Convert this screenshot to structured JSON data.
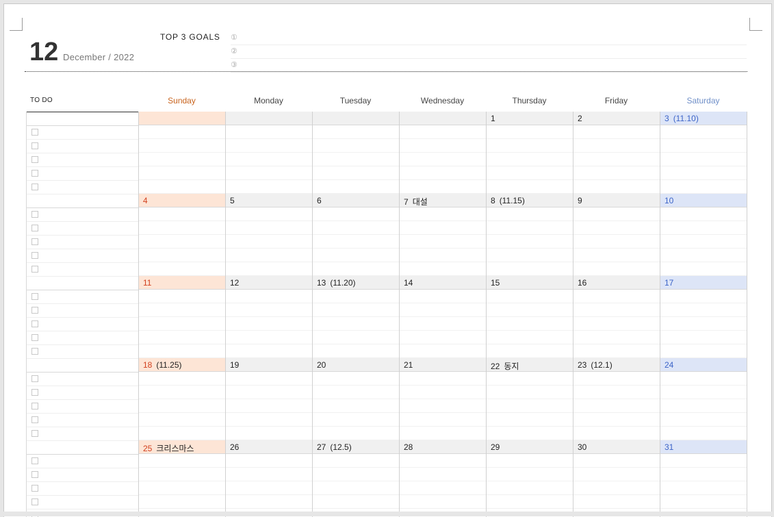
{
  "header": {
    "day_number": "12",
    "month_year": "December / 2022",
    "goals_title": "TOP 3 GOALS",
    "goal_markers": [
      "①",
      "②",
      "③"
    ]
  },
  "calendar": {
    "todo_label": "TO DO",
    "weekdays": [
      "Sunday",
      "Monday",
      "Tuesday",
      "Wednesday",
      "Thursday",
      "Friday",
      "Saturday"
    ],
    "weeks": [
      [
        {
          "d": "",
          "n": ""
        },
        {
          "d": "",
          "n": ""
        },
        {
          "d": "",
          "n": ""
        },
        {
          "d": "",
          "n": ""
        },
        {
          "d": "1",
          "n": ""
        },
        {
          "d": "2",
          "n": ""
        },
        {
          "d": "3",
          "n": "(11.10)"
        }
      ],
      [
        {
          "d": "4",
          "n": ""
        },
        {
          "d": "5",
          "n": ""
        },
        {
          "d": "6",
          "n": ""
        },
        {
          "d": "7",
          "n": "대설"
        },
        {
          "d": "8",
          "n": "(11.15)"
        },
        {
          "d": "9",
          "n": ""
        },
        {
          "d": "10",
          "n": ""
        }
      ],
      [
        {
          "d": "11",
          "n": ""
        },
        {
          "d": "12",
          "n": ""
        },
        {
          "d": "13",
          "n": "(11.20)"
        },
        {
          "d": "14",
          "n": ""
        },
        {
          "d": "15",
          "n": ""
        },
        {
          "d": "16",
          "n": ""
        },
        {
          "d": "17",
          "n": ""
        }
      ],
      [
        {
          "d": "18",
          "n": "(11.25)"
        },
        {
          "d": "19",
          "n": ""
        },
        {
          "d": "20",
          "n": ""
        },
        {
          "d": "21",
          "n": ""
        },
        {
          "d": "22",
          "n": "동지"
        },
        {
          "d": "23",
          "n": "(12.1)"
        },
        {
          "d": "24",
          "n": ""
        }
      ],
      [
        {
          "d": "25",
          "n": "크리스마스"
        },
        {
          "d": "26",
          "n": ""
        },
        {
          "d": "27",
          "n": "(12.5)"
        },
        {
          "d": "28",
          "n": ""
        },
        {
          "d": "29",
          "n": ""
        },
        {
          "d": "30",
          "n": ""
        },
        {
          "d": "31",
          "n": ""
        }
      ]
    ]
  },
  "colors": {
    "sunday_text": "#d2401e",
    "sunday_bg": "#fde5d6",
    "saturday_text": "#3c64c8",
    "saturday_bg": "#dde5f7"
  }
}
